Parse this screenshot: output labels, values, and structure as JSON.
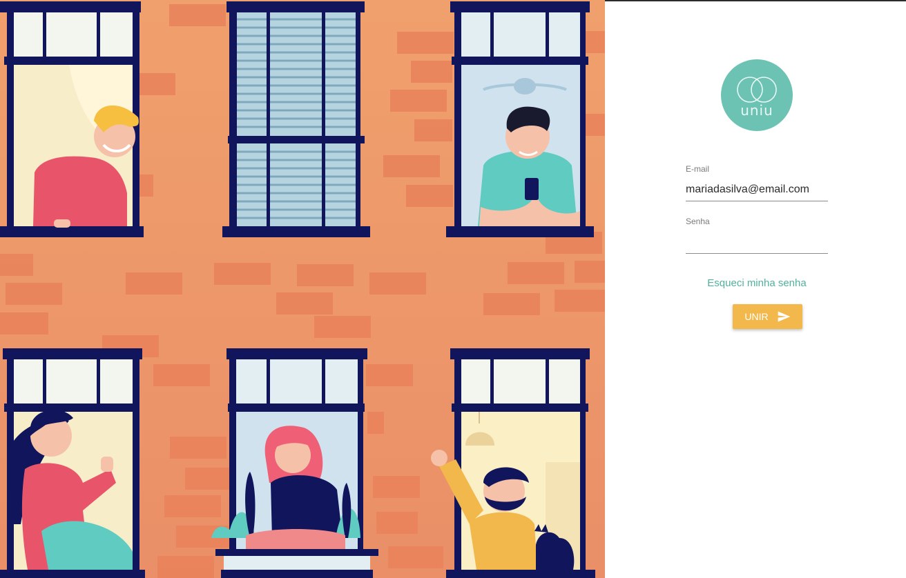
{
  "brand": {
    "logo_text": "uniu",
    "accent": "#6cc3b3"
  },
  "login": {
    "email_label": "E-mail",
    "email_value": "mariadasilva@email.com",
    "password_label": "Senha",
    "password_value": "",
    "forgot_link": "Esqueci minha senha",
    "submit_label": "UNIR",
    "submit_icon": "send-icon"
  },
  "colors": {
    "wall": "#ee9768",
    "window_frame": "#10155c",
    "button": "#f2b84b",
    "link": "#4fb39c"
  }
}
